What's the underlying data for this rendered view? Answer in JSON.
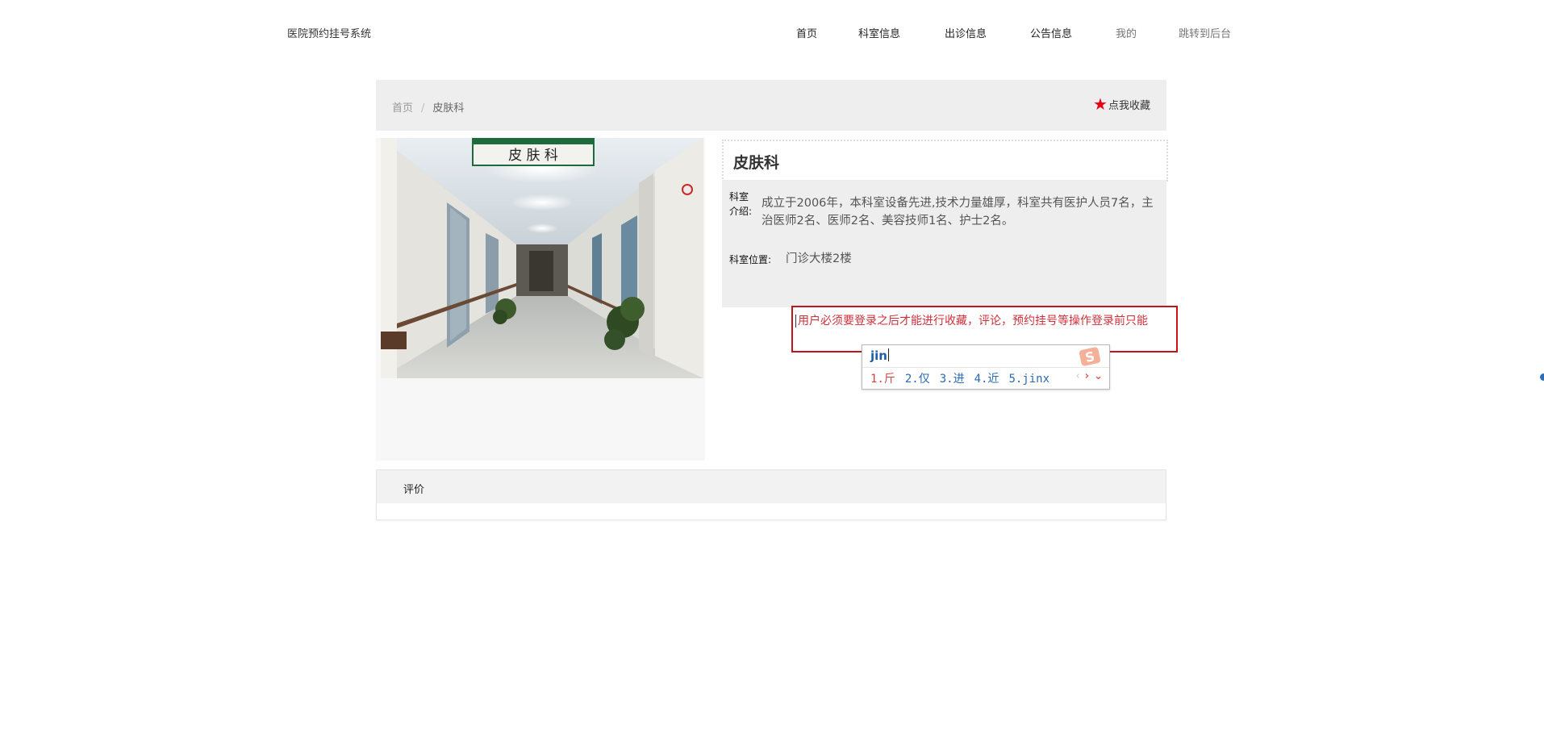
{
  "header": {
    "site_title": "医院预约挂号系统",
    "nav": [
      {
        "label": "首页"
      },
      {
        "label": "科室信息"
      },
      {
        "label": "出诊信息"
      },
      {
        "label": "公告信息"
      },
      {
        "label": "我的"
      },
      {
        "label": "跳转到后台"
      }
    ]
  },
  "breadcrumb": {
    "home": "首页",
    "separator": "/",
    "current": "皮肤科"
  },
  "favorite": {
    "label": "点我收藏",
    "icon": "star-icon",
    "color": "#e60012"
  },
  "department": {
    "name": "皮肤科",
    "intro_label": "科室介绍:",
    "intro_text": "成立于2006年，本科室设备先进,技术力量雄厚，科室共有医护人员7名，主治医师2名、医师2名、美容技师1名、护士2名。",
    "location_label": "科室位置:",
    "location_text": "门诊大楼2楼",
    "photo_sign": "皮 肤 科"
  },
  "login_notice": {
    "text": "用户必须要登录之后才能进行收藏，评论，预约挂号等操作登录前只能",
    "border_color": "#c5131b"
  },
  "ime": {
    "input": "jin",
    "candidates": [
      "1.斤",
      "2.仅",
      "3.进",
      "4.近",
      "5.jinx"
    ],
    "logo": "sogou-s-icon"
  },
  "review": {
    "label": "评价"
  }
}
